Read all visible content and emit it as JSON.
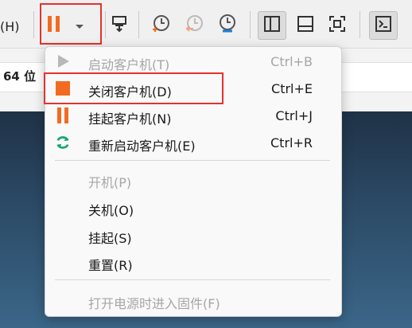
{
  "toolbar": {
    "left_text": "(H)",
    "icons": {
      "pause": "pause-icon",
      "dropdown": "chevron-down-icon",
      "network": "network-icon",
      "snapshot": "snapshot-icon",
      "revert": "revert-snapshot-icon",
      "manage": "manage-snapshots-icon",
      "view_normal": "view-sidebar-icon",
      "view_console": "view-console-icon",
      "fullscreen": "fullscreen-icon",
      "terminal": "terminal-icon"
    },
    "accent_color": "#f26b21",
    "highlight_color": "#e5322d"
  },
  "background": {
    "info_text": "64 位"
  },
  "menu": {
    "items": [
      {
        "label": "启动客户机(T)",
        "shortcut": "Ctrl+B",
        "icon": "play-icon",
        "disabled": true
      },
      {
        "label": "关闭客户机(D)",
        "shortcut": "Ctrl+E",
        "icon": "stop-icon",
        "disabled": false
      },
      {
        "label": "挂起客户机(N)",
        "shortcut": "Ctrl+J",
        "icon": "pause-icon",
        "disabled": false
      },
      {
        "label": "重新启动客户机(E)",
        "shortcut": "Ctrl+R",
        "icon": "restart-icon",
        "disabled": false
      },
      {
        "label": "开机(P)",
        "shortcut": "",
        "icon": "",
        "disabled": true
      },
      {
        "label": "关机(O)",
        "shortcut": "",
        "icon": "",
        "disabled": false
      },
      {
        "label": "挂起(S)",
        "shortcut": "",
        "icon": "",
        "disabled": false
      },
      {
        "label": "重置(R)",
        "shortcut": "",
        "icon": "",
        "disabled": false
      },
      {
        "label": "打开电源时进入固件(F)",
        "shortcut": "",
        "icon": "",
        "disabled": true
      }
    ]
  }
}
